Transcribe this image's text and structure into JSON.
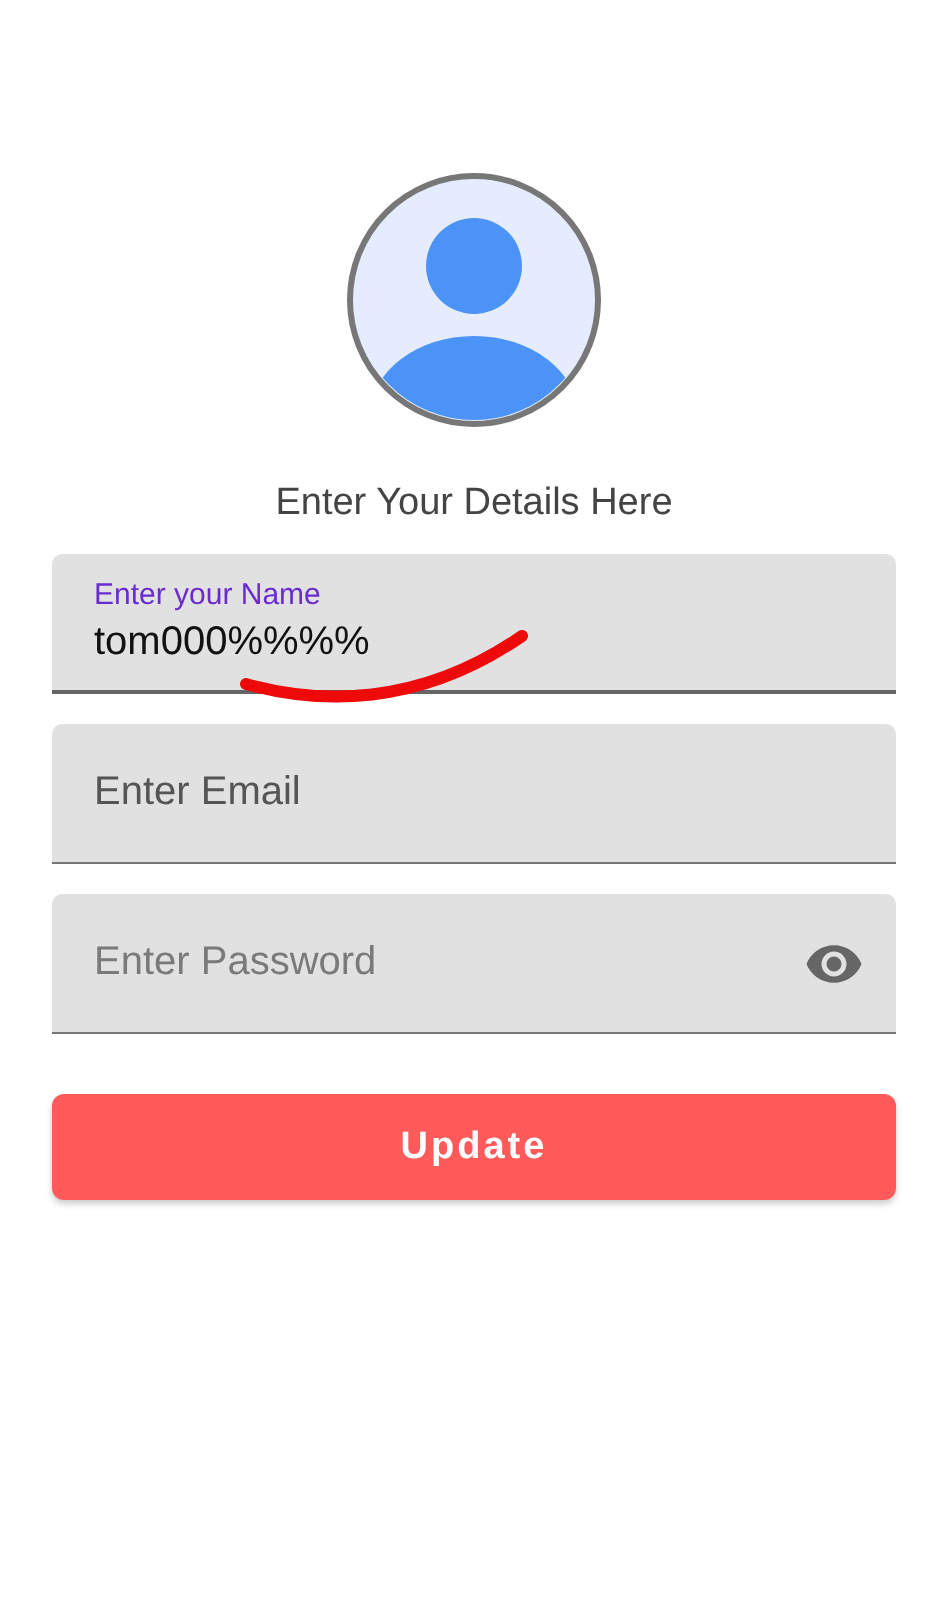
{
  "heading": "Enter Your Details Here",
  "fields": [
    {
      "kind": "text",
      "label": "Enter your Name",
      "value": "tom000%%%%",
      "focused": true
    },
    {
      "kind": "text",
      "label": "Enter Email",
      "focused": false
    },
    {
      "kind": "password",
      "placeholder": "Enter Password",
      "focused": false
    }
  ],
  "button": "Update"
}
